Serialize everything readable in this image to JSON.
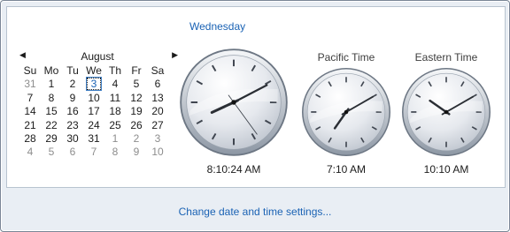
{
  "header": {
    "day": "Wednesday"
  },
  "calendar": {
    "prev_icon": "triangle-left-icon",
    "next_icon": "triangle-right-icon",
    "month": "August",
    "weekdays": [
      "Su",
      "Mo",
      "Tu",
      "We",
      "Th",
      "Fr",
      "Sa"
    ],
    "weeks": [
      [
        {
          "d": "31",
          "other": true
        },
        {
          "d": "1"
        },
        {
          "d": "2"
        },
        {
          "d": "3",
          "today": true
        },
        {
          "d": "4"
        },
        {
          "d": "5"
        },
        {
          "d": "6"
        }
      ],
      [
        {
          "d": "7"
        },
        {
          "d": "8"
        },
        {
          "d": "9"
        },
        {
          "d": "10"
        },
        {
          "d": "11"
        },
        {
          "d": "12"
        },
        {
          "d": "13"
        }
      ],
      [
        {
          "d": "14"
        },
        {
          "d": "15"
        },
        {
          "d": "16"
        },
        {
          "d": "17"
        },
        {
          "d": "18"
        },
        {
          "d": "19"
        },
        {
          "d": "20"
        }
      ],
      [
        {
          "d": "21"
        },
        {
          "d": "22"
        },
        {
          "d": "23"
        },
        {
          "d": "24"
        },
        {
          "d": "25"
        },
        {
          "d": "26"
        },
        {
          "d": "27"
        }
      ],
      [
        {
          "d": "28"
        },
        {
          "d": "29"
        },
        {
          "d": "30"
        },
        {
          "d": "31"
        },
        {
          "d": "1",
          "other": true
        },
        {
          "d": "2",
          "other": true
        },
        {
          "d": "3",
          "other": true
        }
      ],
      [
        {
          "d": "4",
          "other": true
        },
        {
          "d": "5",
          "other": true
        },
        {
          "d": "6",
          "other": true
        },
        {
          "d": "7",
          "other": true
        },
        {
          "d": "8",
          "other": true
        },
        {
          "d": "9",
          "other": true
        },
        {
          "d": "10",
          "other": true
        }
      ]
    ]
  },
  "clocks": {
    "local": {
      "label": "",
      "time": "8:10:24 AM",
      "hour": 8,
      "minute": 10,
      "second": 24
    },
    "pacific": {
      "label": "Pacific Time",
      "time": "7:10 AM",
      "hour": 7,
      "minute": 10
    },
    "eastern": {
      "label": "Eastern Time",
      "time": "10:10 AM",
      "hour": 10,
      "minute": 10
    }
  },
  "footer": {
    "link": "Change date and time settings..."
  },
  "colors": {
    "accent": "#1a62b4",
    "border": "#7a8696"
  }
}
